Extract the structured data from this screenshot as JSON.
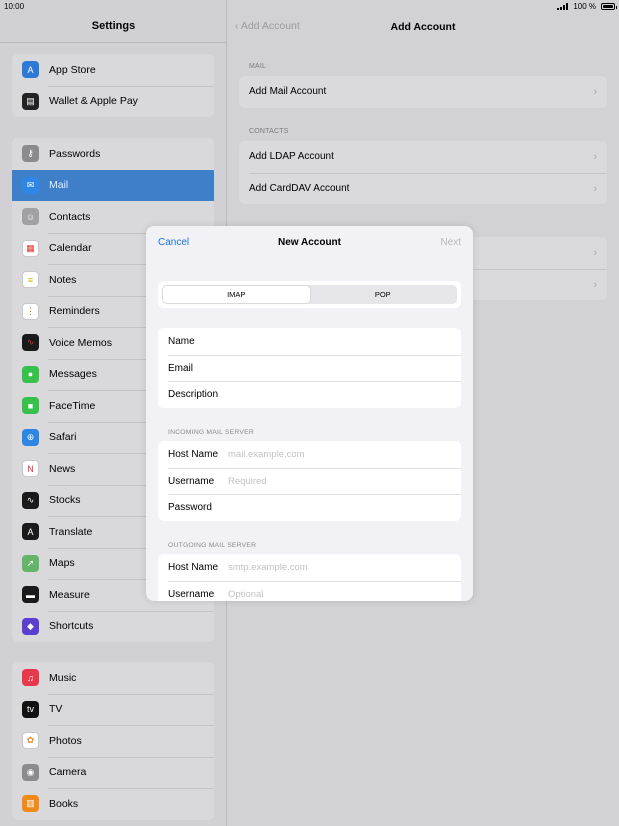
{
  "status": {
    "time": "10:00",
    "battery": "100 %"
  },
  "sidebar": {
    "title": "Settings",
    "groups": [
      [
        {
          "label": "App Store",
          "icon": "app-store-icon",
          "color": "#2d7ad6",
          "glyph": "A"
        },
        {
          "label": "Wallet & Apple Pay",
          "icon": "wallet-icon",
          "color": "#222222",
          "glyph": "▤"
        }
      ],
      [
        {
          "label": "Passwords",
          "icon": "key-icon",
          "color": "#8a8a8f",
          "glyph": "⚷"
        },
        {
          "label": "Mail",
          "icon": "mail-icon",
          "color": "#2f86e6",
          "glyph": "✉",
          "selected": true
        },
        {
          "label": "Contacts",
          "icon": "contacts-icon",
          "color": "#a0a0a5",
          "glyph": "☺"
        },
        {
          "label": "Calendar",
          "icon": "calendar-icon",
          "color": "#ffffff",
          "glyph": "▦",
          "fg": "#e03030"
        },
        {
          "label": "Notes",
          "icon": "notes-icon",
          "color": "#ffffff",
          "glyph": "≡",
          "fg": "#d8b000"
        },
        {
          "label": "Reminders",
          "icon": "reminders-icon",
          "color": "#ffffff",
          "glyph": "⋮",
          "fg": "#e06020"
        },
        {
          "label": "Voice Memos",
          "icon": "voice-memos-icon",
          "color": "#1a1a1a",
          "glyph": "∿",
          "fg": "#e03030"
        },
        {
          "label": "Messages",
          "icon": "messages-icon",
          "color": "#35c14a",
          "glyph": "●"
        },
        {
          "label": "FaceTime",
          "icon": "facetime-icon",
          "color": "#35c14a",
          "glyph": "■"
        },
        {
          "label": "Safari",
          "icon": "safari-icon",
          "color": "#2d86e2",
          "glyph": "⊕"
        },
        {
          "label": "News",
          "icon": "news-icon",
          "color": "#ffffff",
          "glyph": "N",
          "fg": "#e03040"
        },
        {
          "label": "Stocks",
          "icon": "stocks-icon",
          "color": "#1a1a1a",
          "glyph": "∿"
        },
        {
          "label": "Translate",
          "icon": "translate-icon",
          "color": "#1a1a1a",
          "glyph": "A"
        },
        {
          "label": "Maps",
          "icon": "maps-icon",
          "color": "#66b36a",
          "glyph": "➚"
        },
        {
          "label": "Measure",
          "icon": "measure-icon",
          "color": "#1a1a1a",
          "glyph": "▬"
        },
        {
          "label": "Shortcuts",
          "icon": "shortcuts-icon",
          "color": "#5a3fd0",
          "glyph": "◆"
        }
      ],
      [
        {
          "label": "Music",
          "icon": "music-icon",
          "color": "#e8384a",
          "glyph": "♫"
        },
        {
          "label": "TV",
          "icon": "tv-icon",
          "color": "#111111",
          "glyph": "tv"
        },
        {
          "label": "Photos",
          "icon": "photos-icon",
          "color": "#ffffff",
          "glyph": "✿",
          "fg": "#e0902a"
        },
        {
          "label": "Camera",
          "icon": "camera-icon",
          "color": "#8a8a8f",
          "glyph": "◉"
        },
        {
          "label": "Books",
          "icon": "books-icon",
          "color": "#f08a1a",
          "glyph": "▥"
        }
      ]
    ]
  },
  "detail": {
    "back_label": "Add Account",
    "title": "Add Account",
    "mail_header": "MAIL",
    "mail_items": [
      "Add Mail Account"
    ],
    "contacts_header": "CONTACTS",
    "contacts_items": [
      "Add LDAP Account",
      "Add CardDAV Account"
    ]
  },
  "modal": {
    "cancel": "Cancel",
    "title": "New Account",
    "next": "Next",
    "segments": [
      "IMAP",
      "POP"
    ],
    "selected_segment": "IMAP",
    "info_fields": [
      "Name",
      "Email",
      "Description"
    ],
    "incoming_header": "INCOMING MAIL SERVER",
    "incoming_fields": [
      {
        "label": "Host Name",
        "placeholder": "mail.example.com"
      },
      {
        "label": "Username",
        "placeholder": "Required"
      },
      {
        "label": "Password",
        "placeholder": ""
      }
    ],
    "outgoing_header": "OUTGOING MAIL SERVER",
    "outgoing_fields": [
      {
        "label": "Host Name",
        "placeholder": "smtp.example.com"
      },
      {
        "label": "Username",
        "placeholder": "Optional"
      }
    ]
  }
}
